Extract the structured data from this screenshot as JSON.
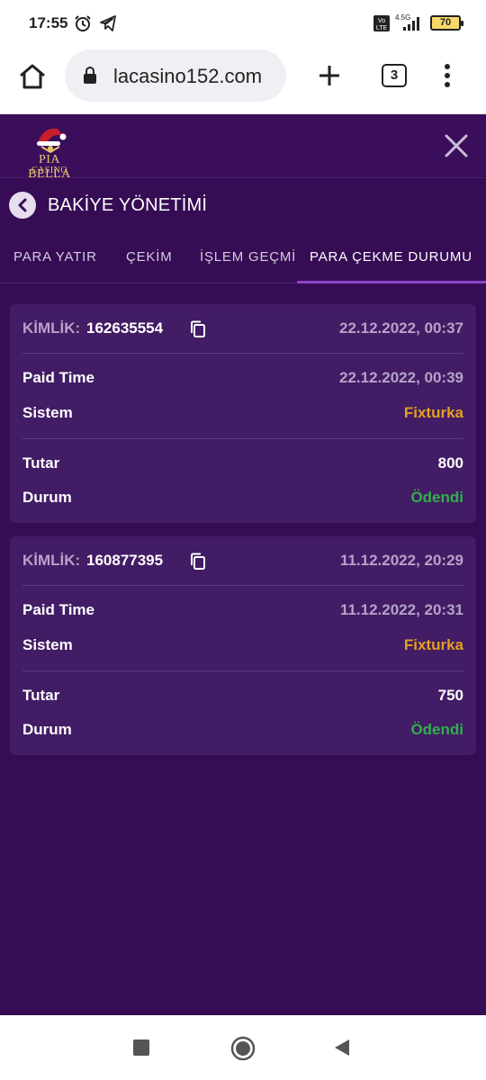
{
  "status_bar": {
    "time": "17:55",
    "network": "4.5G",
    "volte": "Vo LTE",
    "battery": "70",
    "icons": [
      "alarm-icon",
      "telegram-icon",
      "volte-icon",
      "signal-icon",
      "battery-icon"
    ]
  },
  "browser": {
    "url": "lacasino152.com",
    "tab_count": "3",
    "icons": [
      "home-icon",
      "lock-icon",
      "new-tab-icon",
      "tabs-icon",
      "menu-icon"
    ]
  },
  "app": {
    "logo_main": "PIA BELLA",
    "logo_sub": "CASINO",
    "close_icon": "close-icon"
  },
  "page": {
    "title": "BAKİYE YÖNETİMİ"
  },
  "tabs": [
    {
      "label": "PARA YATIR",
      "active": false
    },
    {
      "label": "ÇEKİM",
      "active": false
    },
    {
      "label": "İŞLEM GEÇMİ",
      "active": false
    },
    {
      "label": "PARA ÇEKME DURUMU",
      "active": true
    }
  ],
  "labels": {
    "kimlik": "KİMLİK:",
    "paid_time": "Paid Time",
    "sistem": "Sistem",
    "tutar": "Tutar",
    "durum": "Durum"
  },
  "withdrawals": [
    {
      "id": "162635554",
      "created": "22.12.2022, 00:37",
      "paid_time": "22.12.2022, 00:39",
      "system": "Fixturka",
      "amount": "800",
      "status": "Ödendi"
    },
    {
      "id": "160877395",
      "created": "11.12.2022, 20:29",
      "paid_time": "11.12.2022, 20:31",
      "system": "Fixturka",
      "amount": "750",
      "status": "Ödendi"
    }
  ],
  "colors": {
    "background": "#360c54",
    "card": "#421c65",
    "system_accent": "#e3a020",
    "status_paid": "#2fb14a",
    "tab_indicator": "#8e44c8"
  }
}
